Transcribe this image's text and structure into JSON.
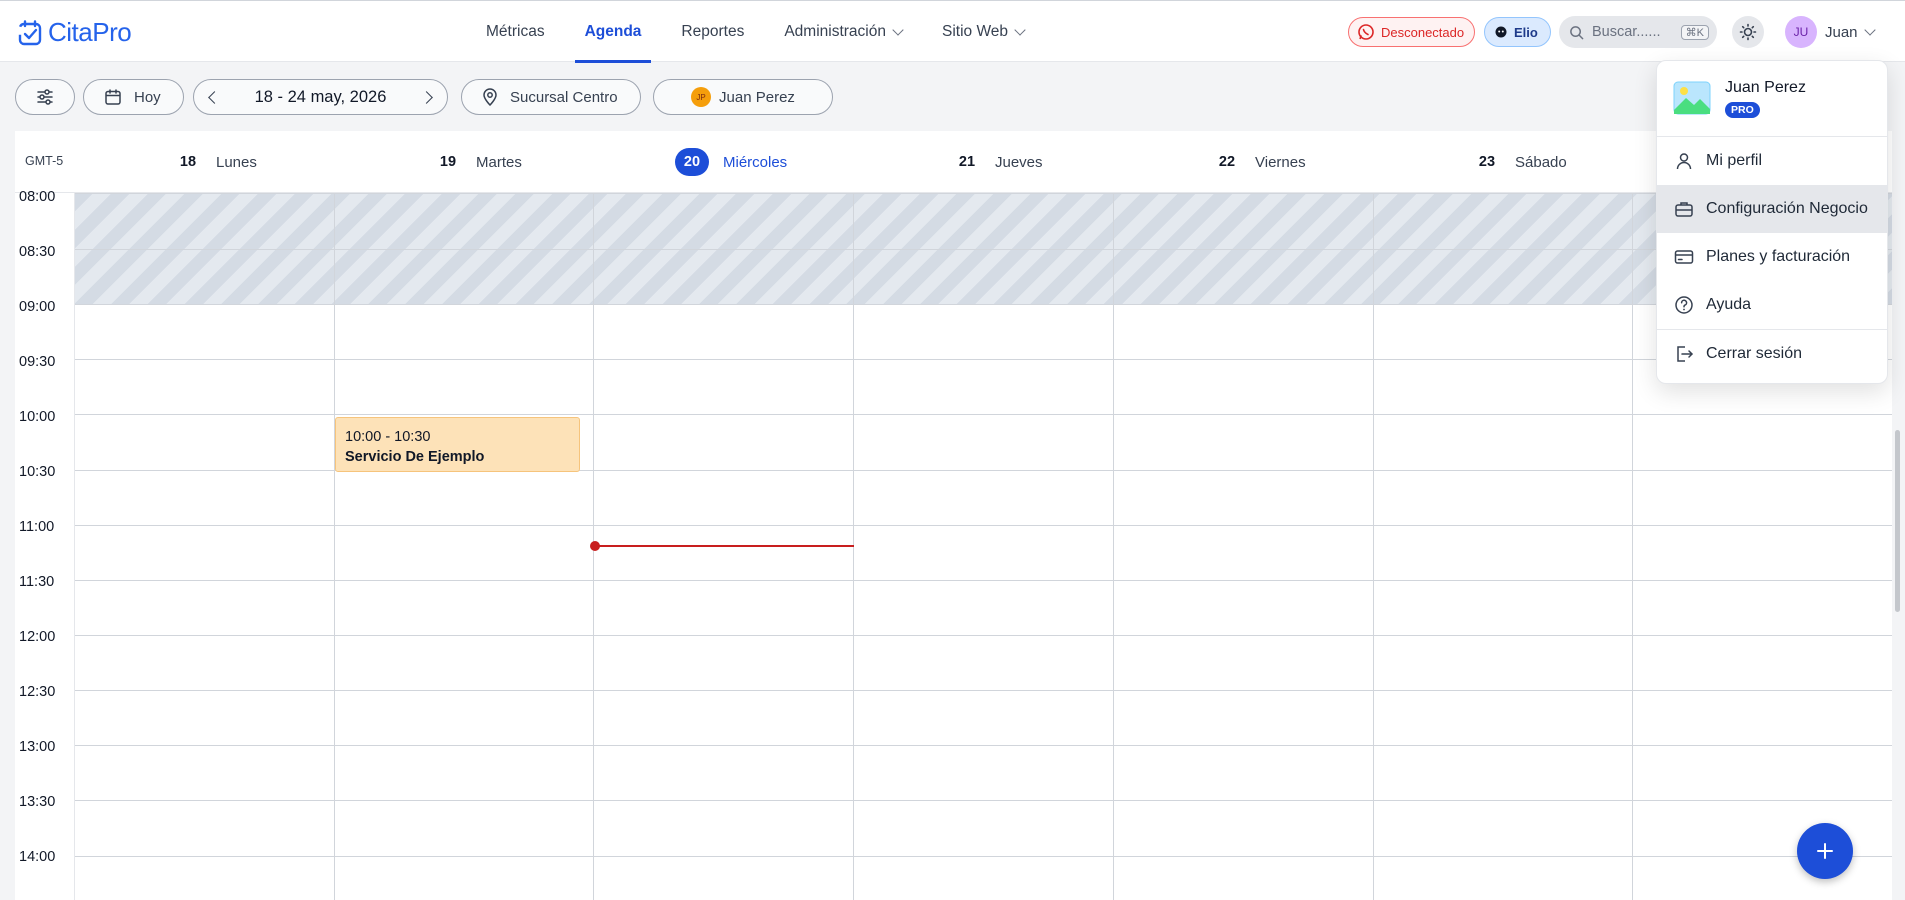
{
  "app": {
    "name": "CitaPro",
    "brand_color": "#2563eb"
  },
  "nav": {
    "items": [
      {
        "label": "Métricas",
        "active": false
      },
      {
        "label": "Agenda",
        "active": true
      },
      {
        "label": "Reportes",
        "active": false
      },
      {
        "label": "Administración",
        "active": false,
        "dropdown": true
      },
      {
        "label": "Sitio Web",
        "active": false,
        "dropdown": true
      }
    ]
  },
  "header": {
    "whatsapp_status": "Desconectado",
    "assistant_label": "Elio",
    "search_placeholder": "Buscar......",
    "search_shortcut": "⌘K",
    "user_initials": "JU",
    "user_name": "Juan"
  },
  "toolbar": {
    "today_label": "Hoy",
    "date_range": "18 - 24 may, 2026",
    "branch": "Sucursal Centro",
    "staff_initials": "JP",
    "staff_name": "Juan Perez"
  },
  "calendar": {
    "timezone": "GMT-5",
    "days": [
      {
        "num": "18",
        "name": "Lunes",
        "today": false
      },
      {
        "num": "19",
        "name": "Martes",
        "today": false
      },
      {
        "num": "20",
        "name": "Miércoles",
        "today": true
      },
      {
        "num": "21",
        "name": "Jueves",
        "today": false
      },
      {
        "num": "22",
        "name": "Viernes",
        "today": false
      },
      {
        "num": "23",
        "name": "Sábado",
        "today": false
      }
    ],
    "times": [
      "08:00",
      "08:30",
      "09:00",
      "09:30",
      "10:00",
      "10:30",
      "11:00",
      "11:30",
      "12:00",
      "12:30",
      "13:00",
      "13:30",
      "14:00"
    ],
    "blocked_range": [
      "08:00",
      "09:00"
    ],
    "events": [
      {
        "time": "10:00 - 10:30",
        "title": "Servicio De Ejemplo",
        "day": "19",
        "color": "#fde2b8"
      }
    ],
    "now_time": "11:11",
    "now_color": "#c81e1e"
  },
  "user_menu": {
    "name": "Juan Perez",
    "badge": "PRO",
    "items": [
      {
        "label": "Mi perfil",
        "icon": "user-icon"
      },
      {
        "label": "Configuración Negocio",
        "icon": "briefcase-icon",
        "hover": true
      },
      {
        "label": "Planes y facturación",
        "icon": "credit-card-icon"
      },
      {
        "label": "Ayuda",
        "icon": "help-icon"
      },
      {
        "label": "Cerrar sesión",
        "icon": "logout-icon"
      }
    ]
  }
}
